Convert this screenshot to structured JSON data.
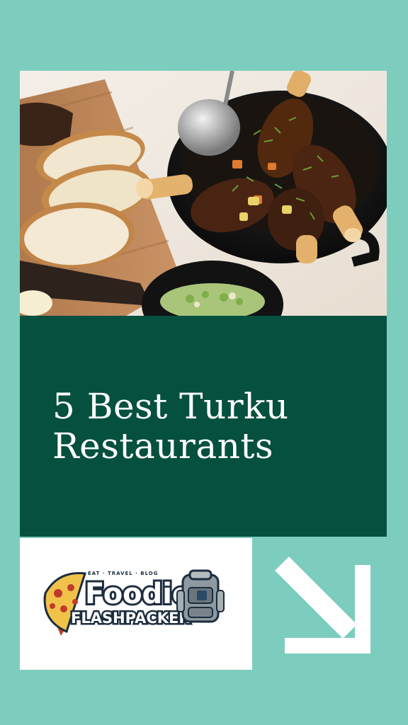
{
  "post": {
    "title": "5 Best Turku Restaurants"
  },
  "logo": {
    "tagline": "EAT · TRAVEL · BLOG",
    "name_line1": "Foodie",
    "name_line2": "FLASHPACKER"
  },
  "icons": {
    "photo": "braised-lamb-shanks-photo",
    "arrow": "arrow-down-right-icon",
    "pizza": "pizza-icon",
    "backpack": "backpack-icon"
  },
  "colors": {
    "background": "#7dcdbf",
    "title_panel": "#06503f",
    "title_text": "#ffffff",
    "logo_text": "#1c2d3e"
  }
}
